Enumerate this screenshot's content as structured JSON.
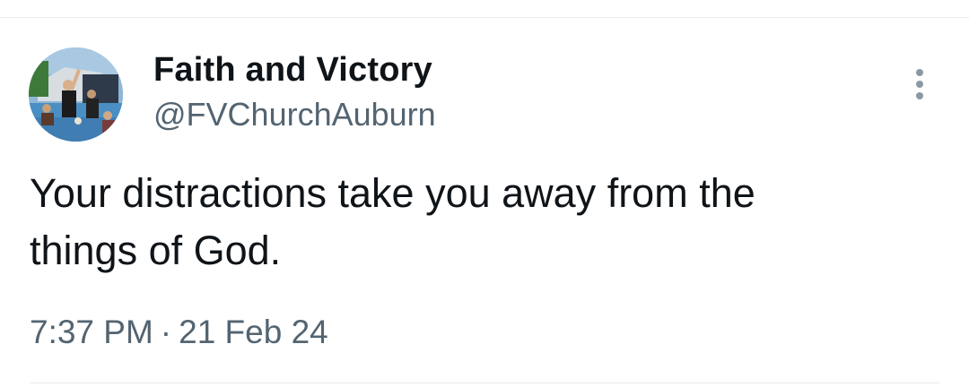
{
  "tweet": {
    "author": {
      "display_name": "Faith and Victory",
      "handle": "@FVChurchAuburn",
      "avatar_icon": "profile-photo"
    },
    "more_icon": "more-vertical-icon",
    "text_lines": [
      "Your distractions take you away from the",
      "things of God."
    ],
    "time": "7:37 PM",
    "separator": "·",
    "date": "21 Feb 24"
  },
  "colors": {
    "primary_text": "#0f1419",
    "secondary_text": "#536471",
    "divider": "#e6e9eb",
    "more_icon": "#8b98a5"
  }
}
